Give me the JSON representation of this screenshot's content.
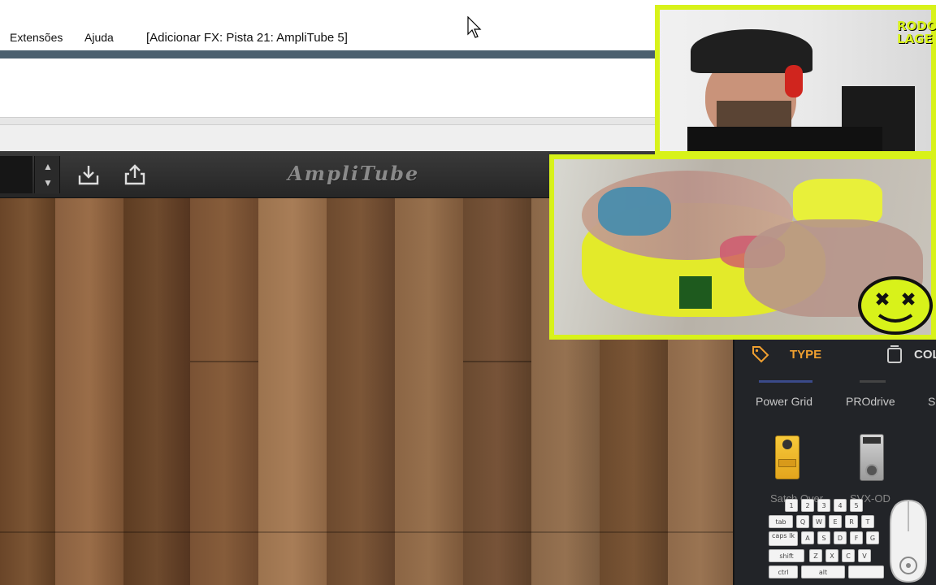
{
  "menubar": {
    "items": [
      "Extensões",
      "Ajuda"
    ],
    "window_title": "[Adicionar FX: Pista 21: AmpliTube 5]"
  },
  "amplitube": {
    "logo": "AmpliTube",
    "toolbar": {
      "spin_up": "▲",
      "spin_down": "▼",
      "import_icon": "download-icon",
      "export_icon": "share-icon"
    }
  },
  "pedal_browser": {
    "tabs": [
      {
        "label": "TYPE",
        "icon": "tag-icon",
        "active": true
      },
      {
        "label": "COL",
        "icon": "collection-icon",
        "active": false
      }
    ],
    "categories": [
      "Power Grid",
      "PROdrive",
      "S"
    ],
    "pedals": [
      {
        "name": "Satch Over",
        "icon": "yellow-pedal-icon"
      },
      {
        "name": "SVX-OD",
        "icon": "silver-pedal-icon"
      }
    ]
  },
  "overlay": {
    "streamer_badge": "RODO LAGE",
    "keyboard_rows": [
      [
        "1",
        "2",
        "3",
        "4",
        "5"
      ],
      [
        "tab",
        "Q",
        "W",
        "E",
        "R",
        "T"
      ],
      [
        "caps lk",
        "A",
        "S",
        "D",
        "F",
        "G"
      ],
      [
        "shift",
        "Z",
        "X",
        "C",
        "V"
      ],
      [
        "ctrl",
        "alt"
      ]
    ]
  },
  "colors": {
    "accent_type_tab": "#f0a030",
    "overlay_frame": "#d8f21a",
    "toolbar_bg": "#2e2e2e",
    "blue_bar": "#4a5f6e"
  }
}
